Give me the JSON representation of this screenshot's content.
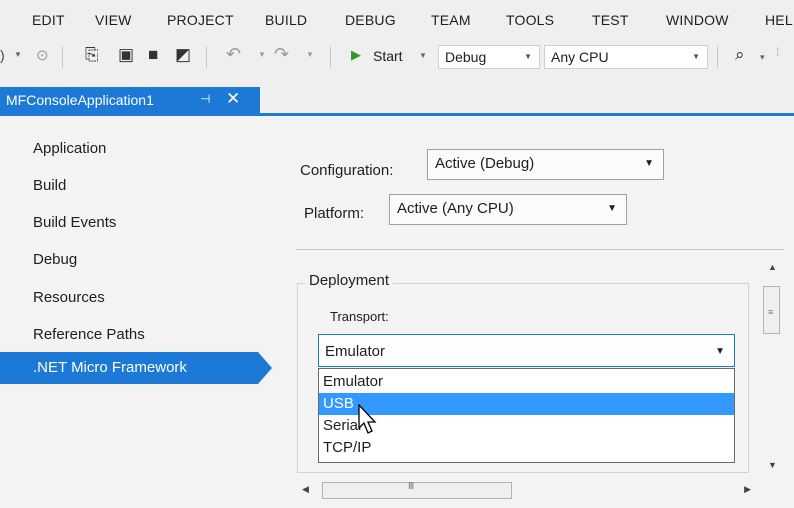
{
  "menu": [
    "EDIT",
    "VIEW",
    "PROJECT",
    "BUILD",
    "DEBUG",
    "TEAM",
    "TOOLS",
    "TEST",
    "WINDOW",
    "HEL"
  ],
  "toolbar": {
    "start_label": "Start",
    "config_value": "Debug",
    "platform_value": "Any CPU"
  },
  "tab": {
    "title": "MFConsoleApplication1",
    "pin": "⊣",
    "close": "✕"
  },
  "nav": {
    "items": [
      "Application",
      "Build",
      "Build Events",
      "Debug",
      "Resources",
      "Reference Paths",
      ".NET Micro Framework"
    ],
    "selected_index": 6
  },
  "main": {
    "configuration_label": "Configuration:",
    "configuration_value": "Active (Debug)",
    "platform_label": "Platform:",
    "platform_value": "Active (Any CPU)",
    "deployment_title": "Deployment",
    "transport_label": "Transport:",
    "transport_value": "Emulator",
    "transport_options": [
      "Emulator",
      "USB",
      "Serial",
      "TCP/IP"
    ],
    "highlighted_option_index": 1
  },
  "colors": {
    "accent": "#1c7ad6",
    "highlight": "#3399ff",
    "background": "#f3f3f3"
  },
  "icons": {
    "scroll_grip_h": "III",
    "scroll_grip_v": "≡"
  }
}
